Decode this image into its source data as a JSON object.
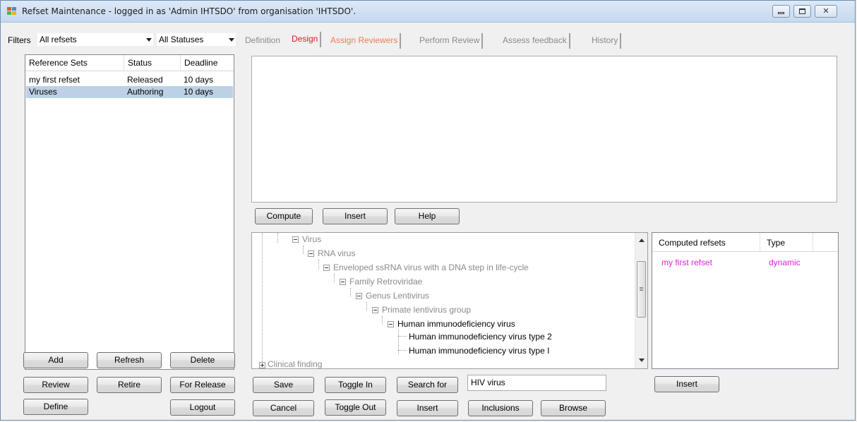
{
  "window": {
    "title": "Refset Maintenance - logged in as 'Admin IHTSDO' from organisation 'IHTSDO'."
  },
  "filters": {
    "label": "Filters",
    "refset_filter": "All refsets",
    "status_filter": "All Statuses"
  },
  "refset_list": {
    "columns": [
      "Reference Sets",
      "Status",
      "Deadline"
    ],
    "rows": [
      {
        "name": "my first refset",
        "status": "Released",
        "deadline": "10 days"
      },
      {
        "name": "Viruses",
        "status": "Authoring",
        "deadline": "10 days"
      }
    ],
    "selected_row": "Viruses"
  },
  "left_buttons": {
    "add": "Add",
    "refresh": "Refresh",
    "delete": "Delete",
    "review": "Review",
    "retire": "Retire",
    "for_release": "For Release",
    "define": "Define",
    "logout": "Logout"
  },
  "tabs": [
    {
      "label": "Definition",
      "color": "#8a8a8a"
    },
    {
      "label": "Design",
      "color": "#d62020"
    },
    {
      "label": "Assign Reviewers",
      "color": "#f07a55"
    },
    {
      "label": "Perform Review",
      "color": "#8a8a8a"
    },
    {
      "label": "Assess feedback",
      "color": "#8a8a8a"
    },
    {
      "label": "History",
      "color": "#8a8a8a"
    }
  ],
  "design": {
    "compute": "Compute",
    "insert": "Insert",
    "help": "Help"
  },
  "tree": {
    "items": [
      {
        "label": "Virus",
        "muted": true
      },
      {
        "label": "RNA virus",
        "muted": true
      },
      {
        "label": "Enveloped ssRNA virus with a DNA step in life-cycle",
        "muted": true
      },
      {
        "label": "Family Retroviridae",
        "muted": true
      },
      {
        "label": "Genus Lentivirus",
        "muted": true
      },
      {
        "label": "Primate lentivirus group",
        "muted": true
      },
      {
        "label": "Human immunodeficiency virus",
        "muted": false
      },
      {
        "label": "Human immunodeficiency virus type 2",
        "muted": false
      },
      {
        "label": "Human immunodeficiency virus type I",
        "muted": false
      },
      {
        "label": "Clinical finding",
        "muted": true
      }
    ]
  },
  "computed_refsets": {
    "columns": [
      "Computed refsets",
      "Type"
    ],
    "rows": [
      {
        "name": "my first refset",
        "type": "dynamic"
      }
    ],
    "row_color": "#e020e0"
  },
  "bottom": {
    "save": "Save",
    "toggle_in": "Toggle In",
    "search_for": "Search for",
    "search_value": "HIV virus",
    "cancel": "Cancel",
    "toggle_out": "Toggle Out",
    "insert": "Insert",
    "inclusions": "Inclusions",
    "browse": "Browse",
    "computed_insert": "Insert"
  },
  "colors": {
    "selection": "#bcd0e6",
    "muted_text": "#8a8a8a"
  }
}
